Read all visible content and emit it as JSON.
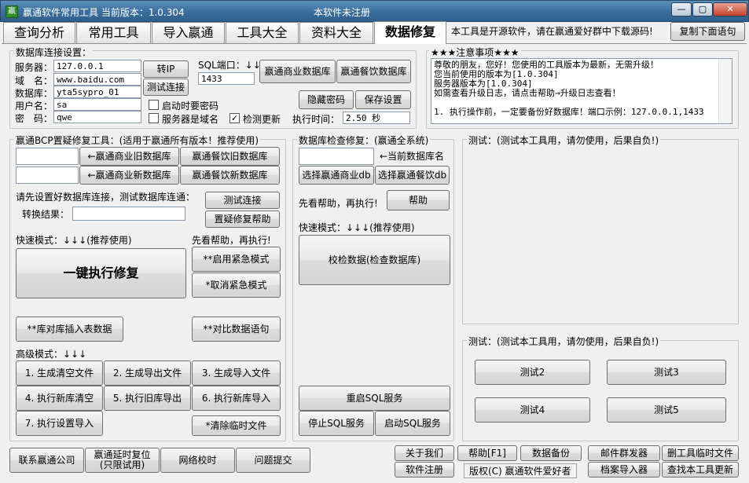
{
  "window": {
    "title": "嬴通软件常用工具  当前版本：1.0.304",
    "status": "本软件未注册",
    "app_icon": "app-icon",
    "minimize": "—",
    "maximize": "▢",
    "close": "✕"
  },
  "tabs": [
    {
      "label": "查询分析"
    },
    {
      "label": "常用工具"
    },
    {
      "label": "导入嬴通"
    },
    {
      "label": "工具大全"
    },
    {
      "label": "资料大全"
    },
    {
      "label": "数据修复"
    }
  ],
  "header": {
    "notice": "本工具是开源软件，请在嬴通爱好群中下载源码!",
    "copy_button": "复制下面语句"
  },
  "db_connection": {
    "title": "数据库连接设置：",
    "server_label": "服务器：",
    "server_value": "127.0.0.1",
    "domain_label": "域　名：",
    "domain_value": "www.baidu.com",
    "database_label": "数据库：",
    "database_value": "yta5sypro_01",
    "username_label": "用户名：",
    "username_value": "sa",
    "password_label": "密　码：",
    "password_value": "qwe",
    "btn_ip": "转IP",
    "btn_test": "测试连接",
    "sql_port_label": "SQL端口：↓↓",
    "sql_port_value": "1433",
    "btn_commerce_db": "嬴通商业数据库",
    "btn_catering_db": "嬴通餐饮数据库",
    "chk_startup_password": "启动时要密码",
    "chk_server_is_domain": "服务器是域名",
    "chk_check_update": "检测更新",
    "btn_hide_password": "隐藏密码",
    "btn_save_settings": "保存设置",
    "exec_time_label": "执行时间：",
    "exec_time_value": "2.50 秒"
  },
  "notes": {
    "title": "★★★注意事项★★★",
    "lines": [
      "尊敬的朋友，您好！您使用的工具版本为最新，无需升级！",
      "您当前使用的版本为[1.0.304]",
      "服务器版本为[1.0.304]",
      "如需查看升级日志，请点击帮助→升级日志查看！",
      "",
      "1. 执行操作前，一定要备份好数据库！端口示例：127.0.0.1,1433"
    ]
  },
  "bcp": {
    "title": "嬴通BCP置疑修复工具：(适用于嬴通所有版本！推荐使用)",
    "btn_commerce_old": "←嬴通商业旧数据库",
    "btn_catering_old": "嬴通餐饮旧数据库",
    "btn_commerce_new": "←嬴通商业新数据库",
    "btn_catering_new": "嬴通餐饮新数据库",
    "hint": "请先设置好数据库连接，测试数据库连通：",
    "btn_test_connection": "测试连接",
    "convert_label": "转换结果：",
    "btn_repair_help": "置疑修复帮助",
    "quick_mode": "快速模式：↓↓↓(推荐使用)",
    "help_first": "先看帮助，再执行!",
    "btn_one_click": "一键执行修复",
    "btn_emergency_on": "**启用紧急模式",
    "btn_emergency_off": "*取消紧急模式",
    "btn_insert_table": "**库对库插入表数据",
    "btn_compare": "**对比数据语句",
    "advanced_mode": "高级模式：↓↓↓",
    "steps": [
      "1. 生成清空文件",
      "2. 生成导出文件",
      "3. 生成导入文件",
      "4. 执行新库清空",
      "5. 执行旧库导出",
      "6. 执行新库导入",
      "7. 执行设置导入"
    ],
    "btn_clear_temp": "*清除临时文件"
  },
  "db_check": {
    "title": "数据库检查修复：(嬴通全系统)",
    "current_db_label": "←当前数据库名",
    "btn_select_commerce": "选择嬴通商业db",
    "btn_select_catering": "选择嬴通餐饮db",
    "help_first": "先看帮助，再执行!",
    "btn_help": "帮助",
    "quick_mode": "快速模式：↓↓↓(推荐使用)",
    "btn_verify": "校检数据(检查数据库)",
    "btn_restart_sql": "重启SQL服务",
    "btn_stop_sql": "停止SQL服务",
    "btn_start_sql": "启动SQL服务"
  },
  "test_panel_1": {
    "title": "测试：(测试本工具用，请勿使用，后果自负!)"
  },
  "test_panel_2": {
    "title": "测试：(测试本工具用，请勿使用，后果自负!)",
    "btn_test2": "测试2",
    "btn_test3": "测试3",
    "btn_test4": "测试4",
    "btn_test5": "测试5"
  },
  "footer": {
    "btn_contact": "联系嬴通公司",
    "btn_delay_reset_1": "嬴通延时复位",
    "btn_delay_reset_2": "(只限试用)",
    "btn_network_time": "网络校时",
    "btn_submit_issue": "问题提交",
    "btn_about": "关于我们",
    "btn_help": "帮助[F1]",
    "btn_backup": "数据备份",
    "btn_mail_sender": "邮件群发器",
    "btn_delete_temp": "删工具临时文件",
    "btn_register": "软件注册",
    "copyright": "版权(C) 嬴通软件爱好者",
    "btn_archive_import": "档案导入器",
    "btn_find_update": "查找本工具更新"
  }
}
